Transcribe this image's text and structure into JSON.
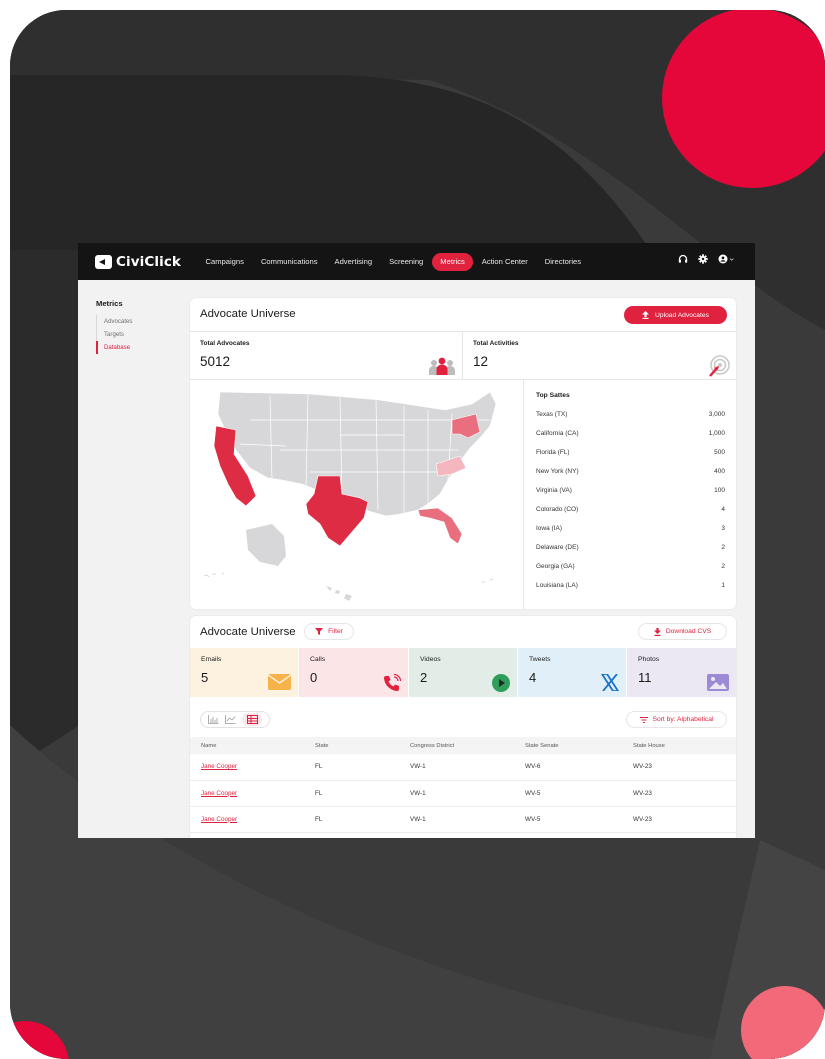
{
  "colors": {
    "accent": "#e0223f",
    "accent_light": "#f06e7e",
    "nav_bg": "#141414",
    "state_dark": "#dd2c44",
    "state_mid": "#e96e7e",
    "state_light": "#f4b6bf",
    "state_gray": "#d7d7d9"
  },
  "nav": {
    "logo": "CiviClick",
    "items": [
      {
        "label": "Campaigns"
      },
      {
        "label": "Communications"
      },
      {
        "label": "Advertising"
      },
      {
        "label": "Screening"
      },
      {
        "label": "Metrics",
        "active": true
      },
      {
        "label": "Action Center"
      },
      {
        "label": "Directories"
      }
    ],
    "icons": [
      "headset-icon",
      "gear-icon",
      "user-icon"
    ]
  },
  "sidebar": {
    "title": "Metrics",
    "items": [
      {
        "label": "Advocates"
      },
      {
        "label": "Targets"
      },
      {
        "label": "Database",
        "active": true
      }
    ]
  },
  "universe": {
    "title": "Advocate Universe",
    "upload_label": "Upload Advocates",
    "total_advocates_label": "Total Advocates",
    "total_advocates_value": "5012",
    "total_activities_label": "Total Activities",
    "total_activities_value": "12",
    "top_states_title": "Top Sattes",
    "top_states": [
      {
        "name": "Texas (TX)",
        "value": "3,000"
      },
      {
        "name": "California (CA)",
        "value": "1,000"
      },
      {
        "name": "Florida (FL)",
        "value": "500"
      },
      {
        "name": "New York (NY)",
        "value": "400"
      },
      {
        "name": "Virginia (VA)",
        "value": "100"
      },
      {
        "name": "Colorado (CO)",
        "value": "4"
      },
      {
        "name": "Iowa (IA)",
        "value": "3"
      },
      {
        "name": "Delaware (DE)",
        "value": "2"
      },
      {
        "name": "Georgia (GA)",
        "value": "2"
      },
      {
        "name": "Louisiana (LA)",
        "value": "1"
      }
    ]
  },
  "activity": {
    "title": "Advocate Universe",
    "filter_label": "Filter",
    "download_label": "Download CVS",
    "sort_label": "Sort by: Alphabetical",
    "metrics": [
      {
        "label": "Emails",
        "value": "5",
        "bg": "#fdf1df",
        "icon": "envelope-icon"
      },
      {
        "label": "Calls",
        "value": "0",
        "bg": "#fbe5e7",
        "icon": "phone-icon"
      },
      {
        "label": "Videos",
        "value": "2",
        "bg": "#e3ede8",
        "icon": "play-icon"
      },
      {
        "label": "Tweets",
        "value": "4",
        "bg": "#e1f0f8",
        "icon": "x-logo-icon"
      },
      {
        "label": "Photos",
        "value": "11",
        "bg": "#ebe8f3",
        "icon": "image-icon"
      }
    ],
    "table": {
      "columns": [
        "Name",
        "State",
        "Congress District",
        "State Senate",
        "State House"
      ],
      "rows": [
        [
          "Jane Cooper",
          "FL",
          "VW-1",
          "WV-6",
          "WV-23"
        ],
        [
          "Jane Cooper",
          "FL",
          "VW-1",
          "WV-5",
          "WV-23"
        ],
        [
          "Jane Cooper",
          "FL",
          "VW-1",
          "WV-5",
          "WV-23"
        ]
      ]
    }
  }
}
